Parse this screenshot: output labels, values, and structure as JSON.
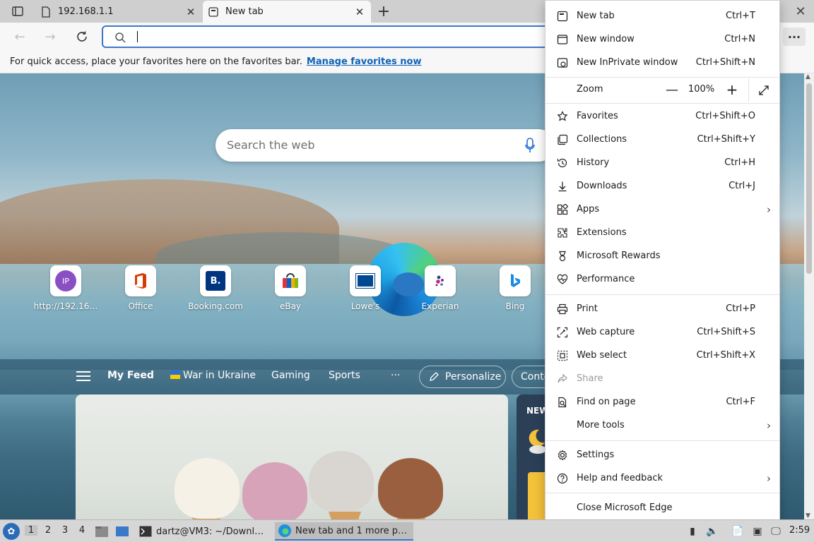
{
  "tabs": [
    {
      "title": "192.168.1.1",
      "active": false
    },
    {
      "title": "New tab",
      "active": true
    }
  ],
  "favorites_bar": {
    "message": "For quick access, place your favorites here on the favorites bar.",
    "link": "Manage favorites now"
  },
  "newtab": {
    "search_placeholder": "Search the web",
    "quick_links": [
      {
        "label": "http://192.16…",
        "icon": "ip-icon"
      },
      {
        "label": "Office",
        "icon": "office-icon"
      },
      {
        "label": "Booking.com",
        "icon": "booking-icon"
      },
      {
        "label": "eBay",
        "icon": "ebay-icon"
      },
      {
        "label": "Lowe's",
        "icon": "lowes-icon"
      },
      {
        "label": "Experian",
        "icon": "experian-icon"
      },
      {
        "label": "Bing",
        "icon": "bing-icon"
      }
    ],
    "ip_badge": "IP",
    "booking_badge": "B.",
    "feed_nav": {
      "my_feed": "My Feed",
      "ukraine": "War in Ukraine",
      "gaming": "Gaming",
      "sports": "Sports",
      "more": "···",
      "personalize": "Personalize",
      "content": "Conte"
    },
    "side_card_label": "NEW"
  },
  "menu": {
    "items": [
      {
        "label": "New tab",
        "shortcut": "Ctrl+T",
        "icon": "new-tab-icon"
      },
      {
        "label": "New window",
        "shortcut": "Ctrl+N",
        "icon": "new-window-icon"
      },
      {
        "label": "New InPrivate window",
        "shortcut": "Ctrl+Shift+N",
        "icon": "inprivate-icon"
      },
      {
        "label": "Favorites",
        "shortcut": "Ctrl+Shift+O",
        "icon": "favorites-icon"
      },
      {
        "label": "Collections",
        "shortcut": "Ctrl+Shift+Y",
        "icon": "collections-icon"
      },
      {
        "label": "History",
        "shortcut": "Ctrl+H",
        "icon": "history-icon"
      },
      {
        "label": "Downloads",
        "shortcut": "Ctrl+J",
        "icon": "downloads-icon"
      },
      {
        "label": "Apps",
        "shortcut": "",
        "icon": "apps-icon",
        "submenu": true
      },
      {
        "label": "Extensions",
        "shortcut": "",
        "icon": "extensions-icon"
      },
      {
        "label": "Microsoft Rewards",
        "shortcut": "",
        "icon": "rewards-icon"
      },
      {
        "label": "Performance",
        "shortcut": "",
        "icon": "performance-icon"
      },
      {
        "label": "Print",
        "shortcut": "Ctrl+P",
        "icon": "print-icon"
      },
      {
        "label": "Web capture",
        "shortcut": "Ctrl+Shift+S",
        "icon": "web-capture-icon"
      },
      {
        "label": "Web select",
        "shortcut": "Ctrl+Shift+X",
        "icon": "web-select-icon"
      },
      {
        "label": "Share",
        "shortcut": "",
        "icon": "share-icon",
        "disabled": true
      },
      {
        "label": "Find on page",
        "shortcut": "Ctrl+F",
        "icon": "find-icon"
      },
      {
        "label": "More tools",
        "shortcut": "",
        "icon": "",
        "submenu": true
      },
      {
        "label": "Settings",
        "shortcut": "",
        "icon": "settings-icon"
      },
      {
        "label": "Help and feedback",
        "shortcut": "",
        "icon": "help-icon",
        "submenu": true
      },
      {
        "label": "Close Microsoft Edge",
        "shortcut": "",
        "icon": ""
      }
    ],
    "zoom": {
      "label": "Zoom",
      "value": "100%",
      "minus": "—",
      "plus": "+"
    }
  },
  "taskbar": {
    "workspaces": [
      "1",
      "2",
      "3",
      "4"
    ],
    "terminal_task": "dartz@VM3: ~/Downl…",
    "browser_task": "New tab and 1 more p…",
    "clock": "2:59"
  },
  "colors": {
    "accent": "#3a78c9",
    "link": "#0f63b8"
  }
}
